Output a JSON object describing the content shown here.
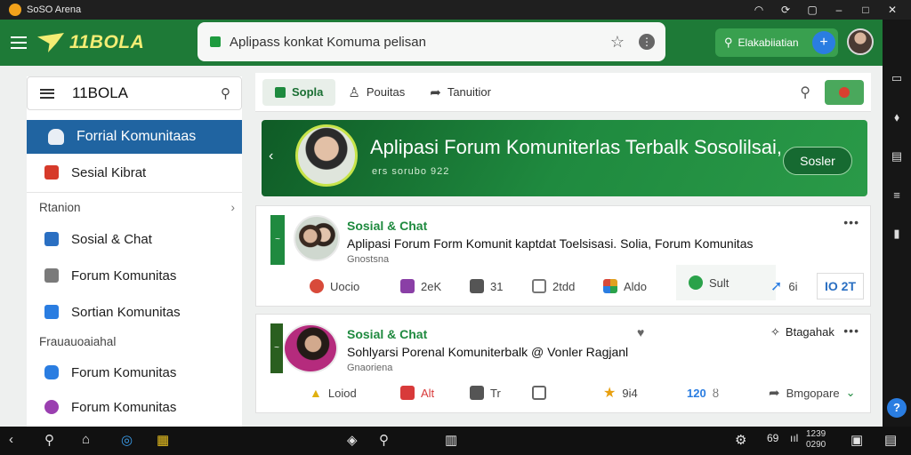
{
  "window": {
    "title": "SoSO Arena"
  },
  "header": {
    "logo_text": "11BOLA",
    "url": "Aplipass konkat Komuma pelisan",
    "search_pill_label": "Elakabiiatian",
    "plus_label": "+"
  },
  "sidebar": {
    "title": "11BOLA",
    "active_item": "Forrial Komunitaas",
    "top_item": "Sesial Kibrat",
    "section1": "Rtanion",
    "section1_items": [
      {
        "label": "Sosial & Chat",
        "icon": "bar-chart-icon",
        "color": "#2a6fc2"
      },
      {
        "label": "Forum Komunitas",
        "icon": "home-icon",
        "color": "#7a7a7a"
      },
      {
        "label": "Sortian Komunitas",
        "icon": "document-icon",
        "color": "#2a7de1"
      }
    ],
    "section2": "Frauauoaiahal",
    "section2_items": [
      {
        "label": "Forum Komunitas",
        "icon": "chat-icon",
        "color": "#2a7de1"
      },
      {
        "label": "Forum Komunitas",
        "icon": "chat-icon",
        "color": "#9a3fb0"
      }
    ]
  },
  "tabs": [
    {
      "label": "Sopla",
      "active": true
    },
    {
      "label": "Pouitas",
      "active": false
    },
    {
      "label": "Tanuitior",
      "active": false
    }
  ],
  "banner": {
    "title": "Aplipasi Forum Komuniterlas Terbalk Sosolilsai,",
    "subtitle": "ers sorubo 922",
    "button": "Sosler"
  },
  "posts": [
    {
      "tag": "~",
      "category": "Sosial & Chat",
      "title": "Aplipasi Forum Form Komunit kaptdat Toelsisasi.  Solia,  Forum  Komunitas",
      "meta": "Gnostsna",
      "actions": [
        {
          "label": "Uocio",
          "icon": "like-icon",
          "color": "#d84a3a"
        },
        {
          "label": "2eK",
          "icon": "comment-icon",
          "color": "#8a3fa6"
        },
        {
          "label": "31",
          "icon": "thumb-icon",
          "color": "#555555"
        },
        {
          "label": "2tdd",
          "icon": "bookmark-icon",
          "color": "#777777"
        },
        {
          "label": "Aldo",
          "icon": "apps-icon",
          "color": "#e0a020"
        },
        {
          "label": "Sult",
          "icon": "chat-bubble-icon",
          "color": "#2aa24a"
        },
        {
          "label": "6i",
          "icon": "share-icon",
          "color": "#2a7de1"
        },
        {
          "label": "IO 2T",
          "icon": "count-icon",
          "color": "#2a6fc2"
        }
      ]
    },
    {
      "tag": "~",
      "category": "Sosial & Chat",
      "title": "Sohlyarsi Porenal Komuniterbalk @ Vonler Ragjanl",
      "meta": "Gnaoriena",
      "extra_label": "Btagahak",
      "actions": [
        {
          "label": "Loiod",
          "icon": "warning-icon",
          "color": "#e0b010"
        },
        {
          "label": "Alt",
          "icon": "mail-icon",
          "color": "#d83a3a"
        },
        {
          "label": "Tr",
          "icon": "thumb-icon",
          "color": "#555555"
        },
        {
          "label": "",
          "icon": "chat-icon",
          "color": "#555555"
        },
        {
          "label": "9i4",
          "icon": "star-icon",
          "color": "#e8a010"
        },
        {
          "label": "120",
          "icon": "count-icon",
          "color": "#2a7de1"
        },
        {
          "label": "Bmgopare",
          "icon": "share-icon",
          "color": "#555555"
        }
      ]
    }
  ],
  "taskbar": {
    "clock_time": "1239",
    "clock_date": "0290"
  }
}
